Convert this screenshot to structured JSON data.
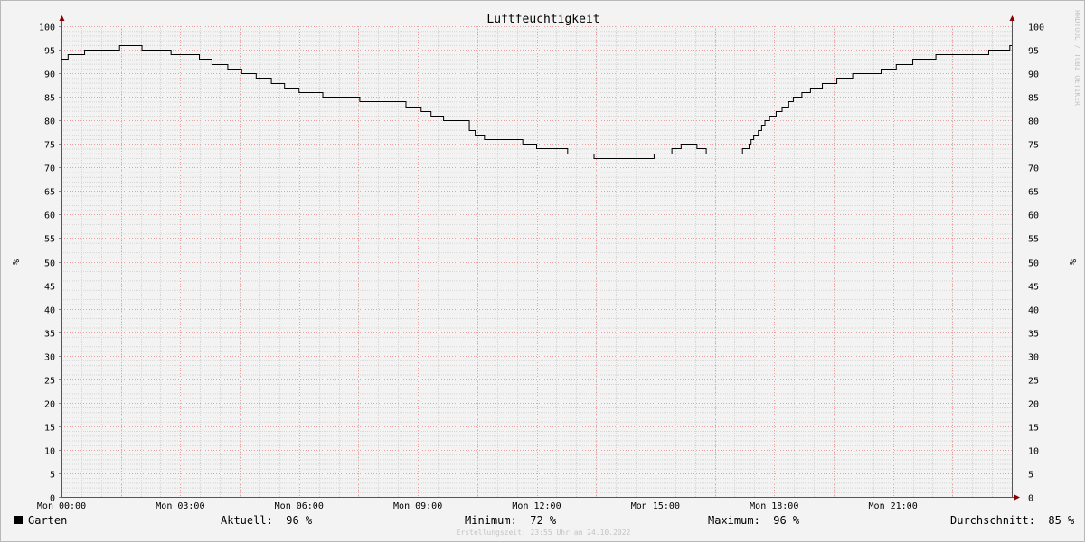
{
  "chart_data": {
    "type": "line",
    "title": "Luftfeuchtigkeit",
    "ylabel": "%",
    "ylim": [
      0,
      100
    ],
    "y_ticks": [
      "0",
      "5",
      "10",
      "15",
      "20",
      "25",
      "30",
      "35",
      "40",
      "45",
      "50",
      "55",
      "60",
      "65",
      "70",
      "75",
      "80",
      "85",
      "90",
      "95",
      "100"
    ],
    "xlim": [
      "Mon 00:00",
      "Tue 00:00"
    ],
    "x_ticks": [
      "Mon 00:00",
      "Mon 03:00",
      "Mon 06:00",
      "Mon 09:00",
      "Mon 12:00",
      "Mon 15:00",
      "Mon 18:00",
      "Mon 21:00"
    ],
    "grid": true,
    "series": [
      {
        "name": "Garten",
        "color": "#000000",
        "step": "post",
        "points": [
          [
            "00:00",
            93
          ],
          [
            "00:10",
            94
          ],
          [
            "00:35",
            95
          ],
          [
            "01:28",
            96
          ],
          [
            "02:02",
            95
          ],
          [
            "02:46",
            94
          ],
          [
            "03:29",
            93
          ],
          [
            "03:48",
            92
          ],
          [
            "04:12",
            91
          ],
          [
            "04:33",
            90
          ],
          [
            "04:55",
            89
          ],
          [
            "05:18",
            88
          ],
          [
            "05:38",
            87
          ],
          [
            "06:00",
            86
          ],
          [
            "06:36",
            85
          ],
          [
            "07:32",
            84
          ],
          [
            "08:42",
            83
          ],
          [
            "09:05",
            82
          ],
          [
            "09:20",
            81
          ],
          [
            "09:39",
            80
          ],
          [
            "10:18",
            78
          ],
          [
            "10:27",
            77
          ],
          [
            "10:41",
            76
          ],
          [
            "11:39",
            75
          ],
          [
            "12:00",
            74
          ],
          [
            "12:47",
            73
          ],
          [
            "13:27",
            72
          ],
          [
            "14:58",
            73
          ],
          [
            "15:25",
            74
          ],
          [
            "15:39",
            75
          ],
          [
            "16:03",
            74
          ],
          [
            "16:17",
            73
          ],
          [
            "17:12",
            74
          ],
          [
            "17:22",
            75
          ],
          [
            "17:25",
            76
          ],
          [
            "17:29",
            77
          ],
          [
            "17:36",
            78
          ],
          [
            "17:41",
            79
          ],
          [
            "17:46",
            80
          ],
          [
            "17:53",
            81
          ],
          [
            "18:03",
            82
          ],
          [
            "18:12",
            83
          ],
          [
            "18:22",
            84
          ],
          [
            "18:29",
            85
          ],
          [
            "18:42",
            86
          ],
          [
            "18:55",
            87
          ],
          [
            "19:13",
            88
          ],
          [
            "19:35",
            89
          ],
          [
            "19:59",
            90
          ],
          [
            "20:42",
            91
          ],
          [
            "21:05",
            92
          ],
          [
            "21:30",
            93
          ],
          [
            "22:05",
            94
          ],
          [
            "23:25",
            95
          ],
          [
            "23:57",
            96
          ],
          [
            "24:00",
            96
          ]
        ]
      }
    ]
  },
  "legend": {
    "series_name": "Garten",
    "aktuell": "Aktuell:  96 %",
    "minimum": "Minimum:  72 %",
    "maximum": "Maximum:  96 %",
    "durchschnitt": "Durchschnitt:  85 %"
  },
  "footer": "Erstellungszeit: 23:55 Uhr am 24.10.2022",
  "watermark": "RRDTOOL / TOBI OETIKER"
}
